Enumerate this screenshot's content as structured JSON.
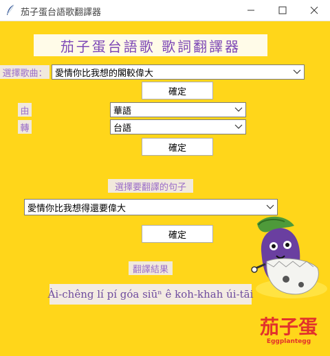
{
  "window": {
    "title": "茄子蛋台語歌翻譯器",
    "icon": "feather-icon",
    "controls": [
      "minimize-icon",
      "maximize-icon",
      "close-icon"
    ]
  },
  "app": {
    "title": "茄子蛋台語歌 歌詞翻譯器"
  },
  "song": {
    "label": "選擇歌曲：",
    "selected": "愛情你比我想的閣較偉大",
    "confirm": "確定"
  },
  "lang": {
    "from_label": "由",
    "from_value": "華語",
    "to_label": "轉",
    "to_value": "台語",
    "confirm": "確定"
  },
  "sentence": {
    "label": "選擇要翻譯的句子",
    "selected": "愛情你比我想得還要偉大",
    "confirm": "確定"
  },
  "result": {
    "label": "翻譯結果",
    "text": "Ài-chêng lí pí góa siūⁿ ê koh-khah úi-tāi"
  },
  "logo": {
    "text": "茄子蛋",
    "subtext": "Eggplantegg"
  },
  "colors": {
    "background": "#ffd61a",
    "accent": "#7d48b6",
    "logo_red": "#e2322b"
  }
}
